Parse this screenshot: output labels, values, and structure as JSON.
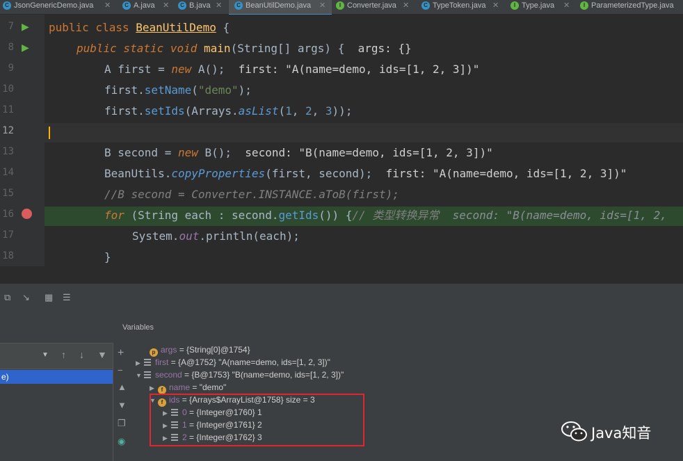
{
  "tabs": [
    {
      "label": "JsonGenericDemo.java",
      "icon": "c"
    },
    {
      "label": "A.java",
      "icon": "c"
    },
    {
      "label": "B.java",
      "icon": "c"
    },
    {
      "label": "BeanUtilDemo.java",
      "icon": "c",
      "active": true
    },
    {
      "label": "Converter.java",
      "icon": "i"
    },
    {
      "label": "TypeToken.java",
      "icon": "c"
    },
    {
      "label": "Type.java",
      "icon": "i"
    },
    {
      "label": "ParameterizedType.java",
      "icon": "i"
    }
  ],
  "editor": {
    "line_numbers": [
      "7",
      "8",
      "9",
      "10",
      "11",
      "12",
      "13",
      "14",
      "15",
      "16",
      "17",
      "18"
    ],
    "hints": {
      "args": "args: {}",
      "first": "first: \"A(name=demo, ids=[1, 2, 3])\"",
      "second": "second: \"B(name=demo, ids=[1, 2, 3])\"",
      "first2": "first: \"A(name=demo, ids=[1, 2, 3])\"",
      "second2": "second: \"B(name=demo, ids=[1, 2,"
    },
    "comment15": "//B second = Converter.INSTANCE.aToB(first);",
    "comment16": "// 类型转换异常"
  },
  "debugger": {
    "variables_label": "Variables",
    "frame_selected": "e)",
    "vars": [
      {
        "name": "args",
        "value": "= {String[0]@1754}"
      },
      {
        "name": "first",
        "value": "= {A@1752} \"A(name=demo, ids=[1, 2, 3])\""
      },
      {
        "name": "second",
        "value": "= {B@1753} \"B(name=demo, ids=[1, 2, 3])\""
      },
      {
        "name": "name",
        "value": "= \"demo\""
      },
      {
        "name": "ids",
        "value": "= {Arrays$ArrayList@1758}  size = 3"
      },
      {
        "name": "0",
        "value": "= {Integer@1760} 1"
      },
      {
        "name": "1",
        "value": "= {Integer@1761} 2"
      },
      {
        "name": "2",
        "value": "= {Integer@1762} 3"
      }
    ]
  },
  "watermark": "Java知音"
}
